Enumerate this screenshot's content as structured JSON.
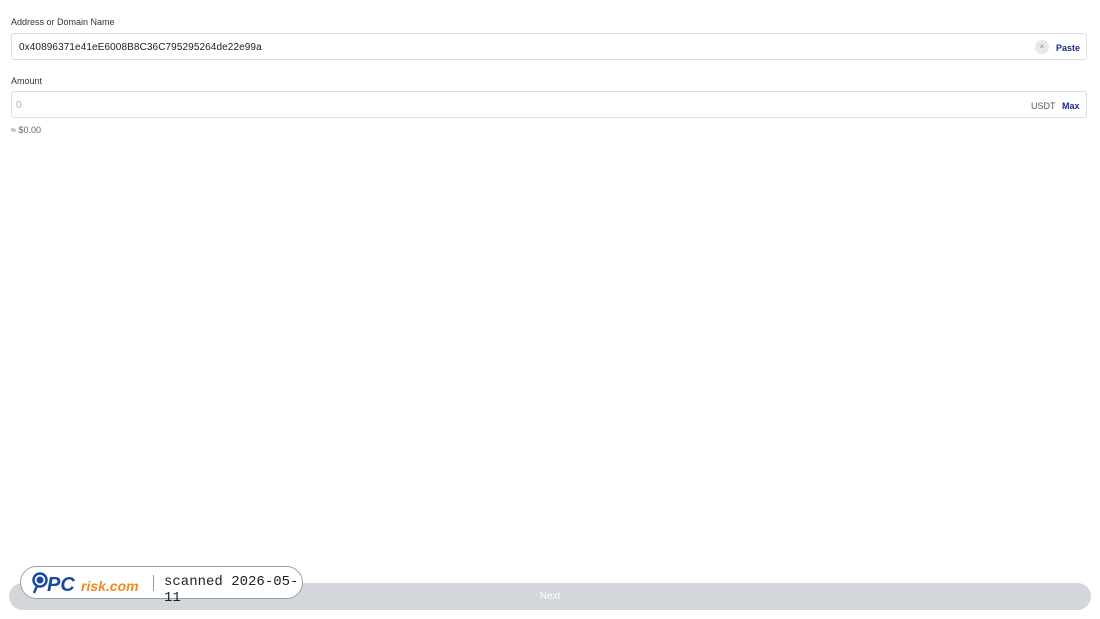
{
  "address": {
    "label": "Address or Domain Name",
    "value": "0x40896371e41eE6008B8C36C795295264de22e99a",
    "clear_icon": "×",
    "paste_label": "Paste"
  },
  "amount": {
    "label": "Amount",
    "placeholder": "0",
    "unit": "USDT",
    "max_label": "Max",
    "fiat_estimate": "≈ $0.00"
  },
  "footer": {
    "next_label": "Next"
  },
  "watermark": {
    "logo_text": "PCrisk.com",
    "scan_text": "scanned 2026-05-11"
  },
  "colors": {
    "accent": "#1a2a8a",
    "button_disabled": "#d3d6db",
    "logo_blue": "#1a4aa0",
    "logo_orange": "#f08a1c"
  }
}
